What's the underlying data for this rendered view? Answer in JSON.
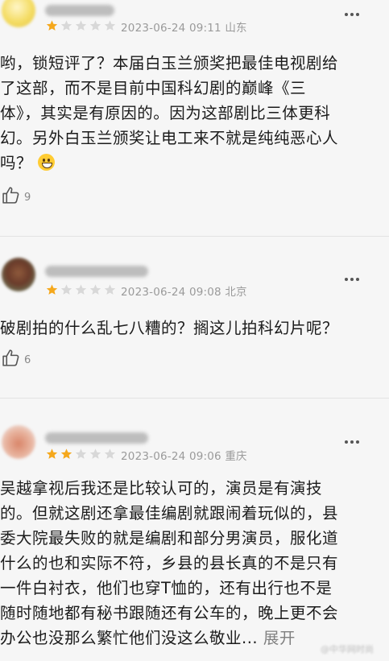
{
  "colors": {
    "star_filled": "#f5a81c",
    "star_empty": "#d8d8d8",
    "meta_text": "#9a9a9a"
  },
  "reviews": [
    {
      "rating": 1,
      "date": "2023-06-24 09:11",
      "location": "山东",
      "lines": [
        "哟，锁短评了？本届白玉兰颁奖把最佳电视剧给",
        "了这部，而不是目前中国科幻剧的巅峰《三",
        "体》，其实是有原因的。因为这部剧比三体更科",
        "幻。另外白玉兰颁奖让电工来不就是纯纯恶心人",
        "吗？"
      ],
      "emoji": "grinning-sweat-emoji",
      "likes": "9"
    },
    {
      "rating": 1,
      "date": "2023-06-24 09:08",
      "location": "北京",
      "lines": [
        "破剧拍的什么乱七八糟的？搁这儿拍科幻片呢？"
      ],
      "likes": "6"
    },
    {
      "rating": 2,
      "date": "2023-06-24 09:06",
      "location": "重庆",
      "lines": [
        "吴越拿视后我还是比较认可的，演员是有演技",
        "的。但就这剧还拿最佳编剧就跟闹着玩似的，县",
        "委大院最失败的就是编剧和部分男演员，服化道",
        "什么的也和实际不符，乡县的县长真的不是只有",
        "一件白衬衣，他们也穿T恤的，还有出行也不是",
        "随时随地都有秘书跟随还有公车的，晚上更不会",
        "办公也没那么繁忙他们没这么敬业..."
      ],
      "expand_label": "展开"
    }
  ]
}
